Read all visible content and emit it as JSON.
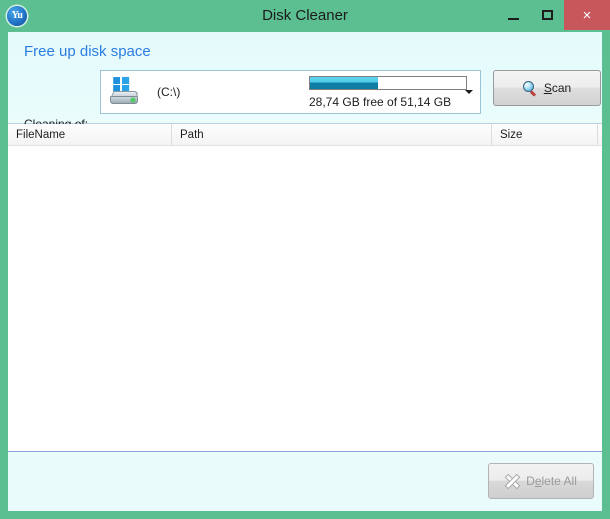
{
  "window": {
    "title": "Disk Cleaner",
    "app_icon": "app-logo-icon",
    "app_icon_text": "Yu",
    "accent_color": "#5cbf92",
    "close_color": "#c8575b",
    "controls": {
      "minimize_label": "–",
      "maximize_label": "□",
      "close_label": "×"
    }
  },
  "header": {
    "heading": "Free up disk space",
    "heading_color": "#2c7de0"
  },
  "drive_selector": {
    "label": "Cleaning of:",
    "icon": "hard-drive-icon",
    "drive_name": "(C:\\)",
    "capacity_text": "28,74 GB free of 51,14 GB",
    "free_gb": "28,74",
    "total_gb": "51,14",
    "used_percent": 43.8,
    "bar_fill_color": "#0f7fa8",
    "bar_highlight_color": "#5fd4ee",
    "dropdown_icon": "chevron-down-icon"
  },
  "toolbar": {
    "scan_label_prefix": "",
    "scan_accel": "S",
    "scan_label_rest": "can",
    "scan_icon": "magnifier-icon"
  },
  "file_list": {
    "columns": [
      {
        "key": "filename",
        "label": "FileName"
      },
      {
        "key": "path",
        "label": "Path"
      },
      {
        "key": "size",
        "label": "Size"
      }
    ],
    "rows": []
  },
  "footer": {
    "delete_icon": "x-mark-icon",
    "delete_label_prefix": "D",
    "delete_accel": "e",
    "delete_label_rest": "lete All",
    "delete_enabled": false
  }
}
